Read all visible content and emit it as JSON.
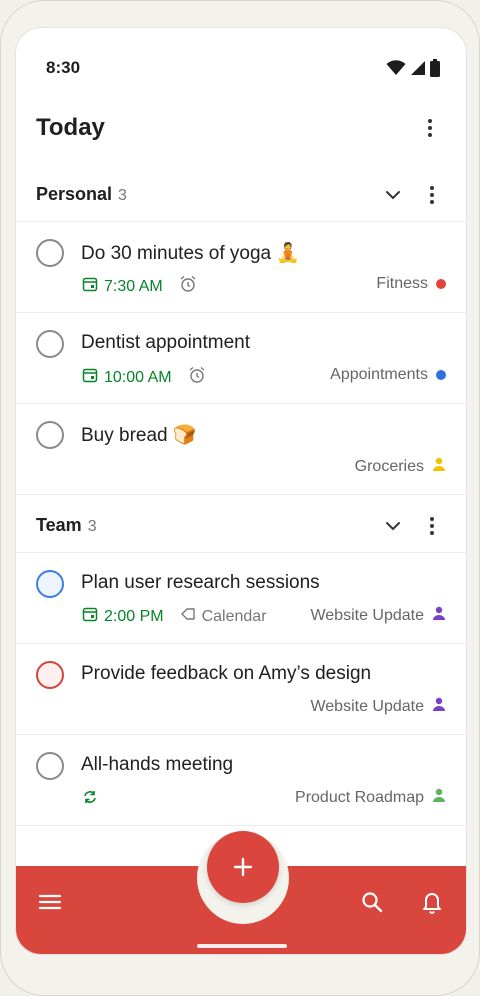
{
  "status": {
    "time": "8:30"
  },
  "header": {
    "title": "Today"
  },
  "sections": [
    {
      "title": "Personal",
      "count": "3",
      "tasks": [
        {
          "title": "Do 30 minutes of yoga",
          "emoji": "🧘",
          "time": "7:30 AM",
          "has_reminder": true,
          "project": "Fitness",
          "project_color": "#e0453a",
          "check_style": "default"
        },
        {
          "title": "Dentist appointment",
          "time": "10:00 AM",
          "has_reminder": true,
          "project": "Appointments",
          "project_color": "#2f6fe0",
          "check_style": "default"
        },
        {
          "title": "Buy bread",
          "emoji": "🍞",
          "project": "Groceries",
          "project_icon": "person-icon",
          "project_color": "#f2c200",
          "check_style": "default"
        }
      ]
    },
    {
      "title": "Team",
      "count": "3",
      "tasks": [
        {
          "title": "Plan user research sessions",
          "time": "2:00 PM",
          "label": "Calendar",
          "project": "Website Update",
          "project_icon": "person-icon",
          "project_color": "#7a3fc4",
          "check_style": "blue"
        },
        {
          "title": "Provide feedback on Amy’s design",
          "project": "Website Update",
          "project_icon": "person-icon",
          "project_color": "#7a3fc4",
          "check_style": "red"
        },
        {
          "title": "All-hands meeting",
          "recurring": true,
          "project": "Product Roadmap",
          "project_icon": "person-icon",
          "project_color": "#5bb55a",
          "check_style": "default"
        }
      ]
    }
  ],
  "bottom_bar": {
    "background": "#d9463d",
    "icons": [
      "menu-icon",
      "add-icon",
      "search-icon",
      "bell-icon"
    ]
  }
}
